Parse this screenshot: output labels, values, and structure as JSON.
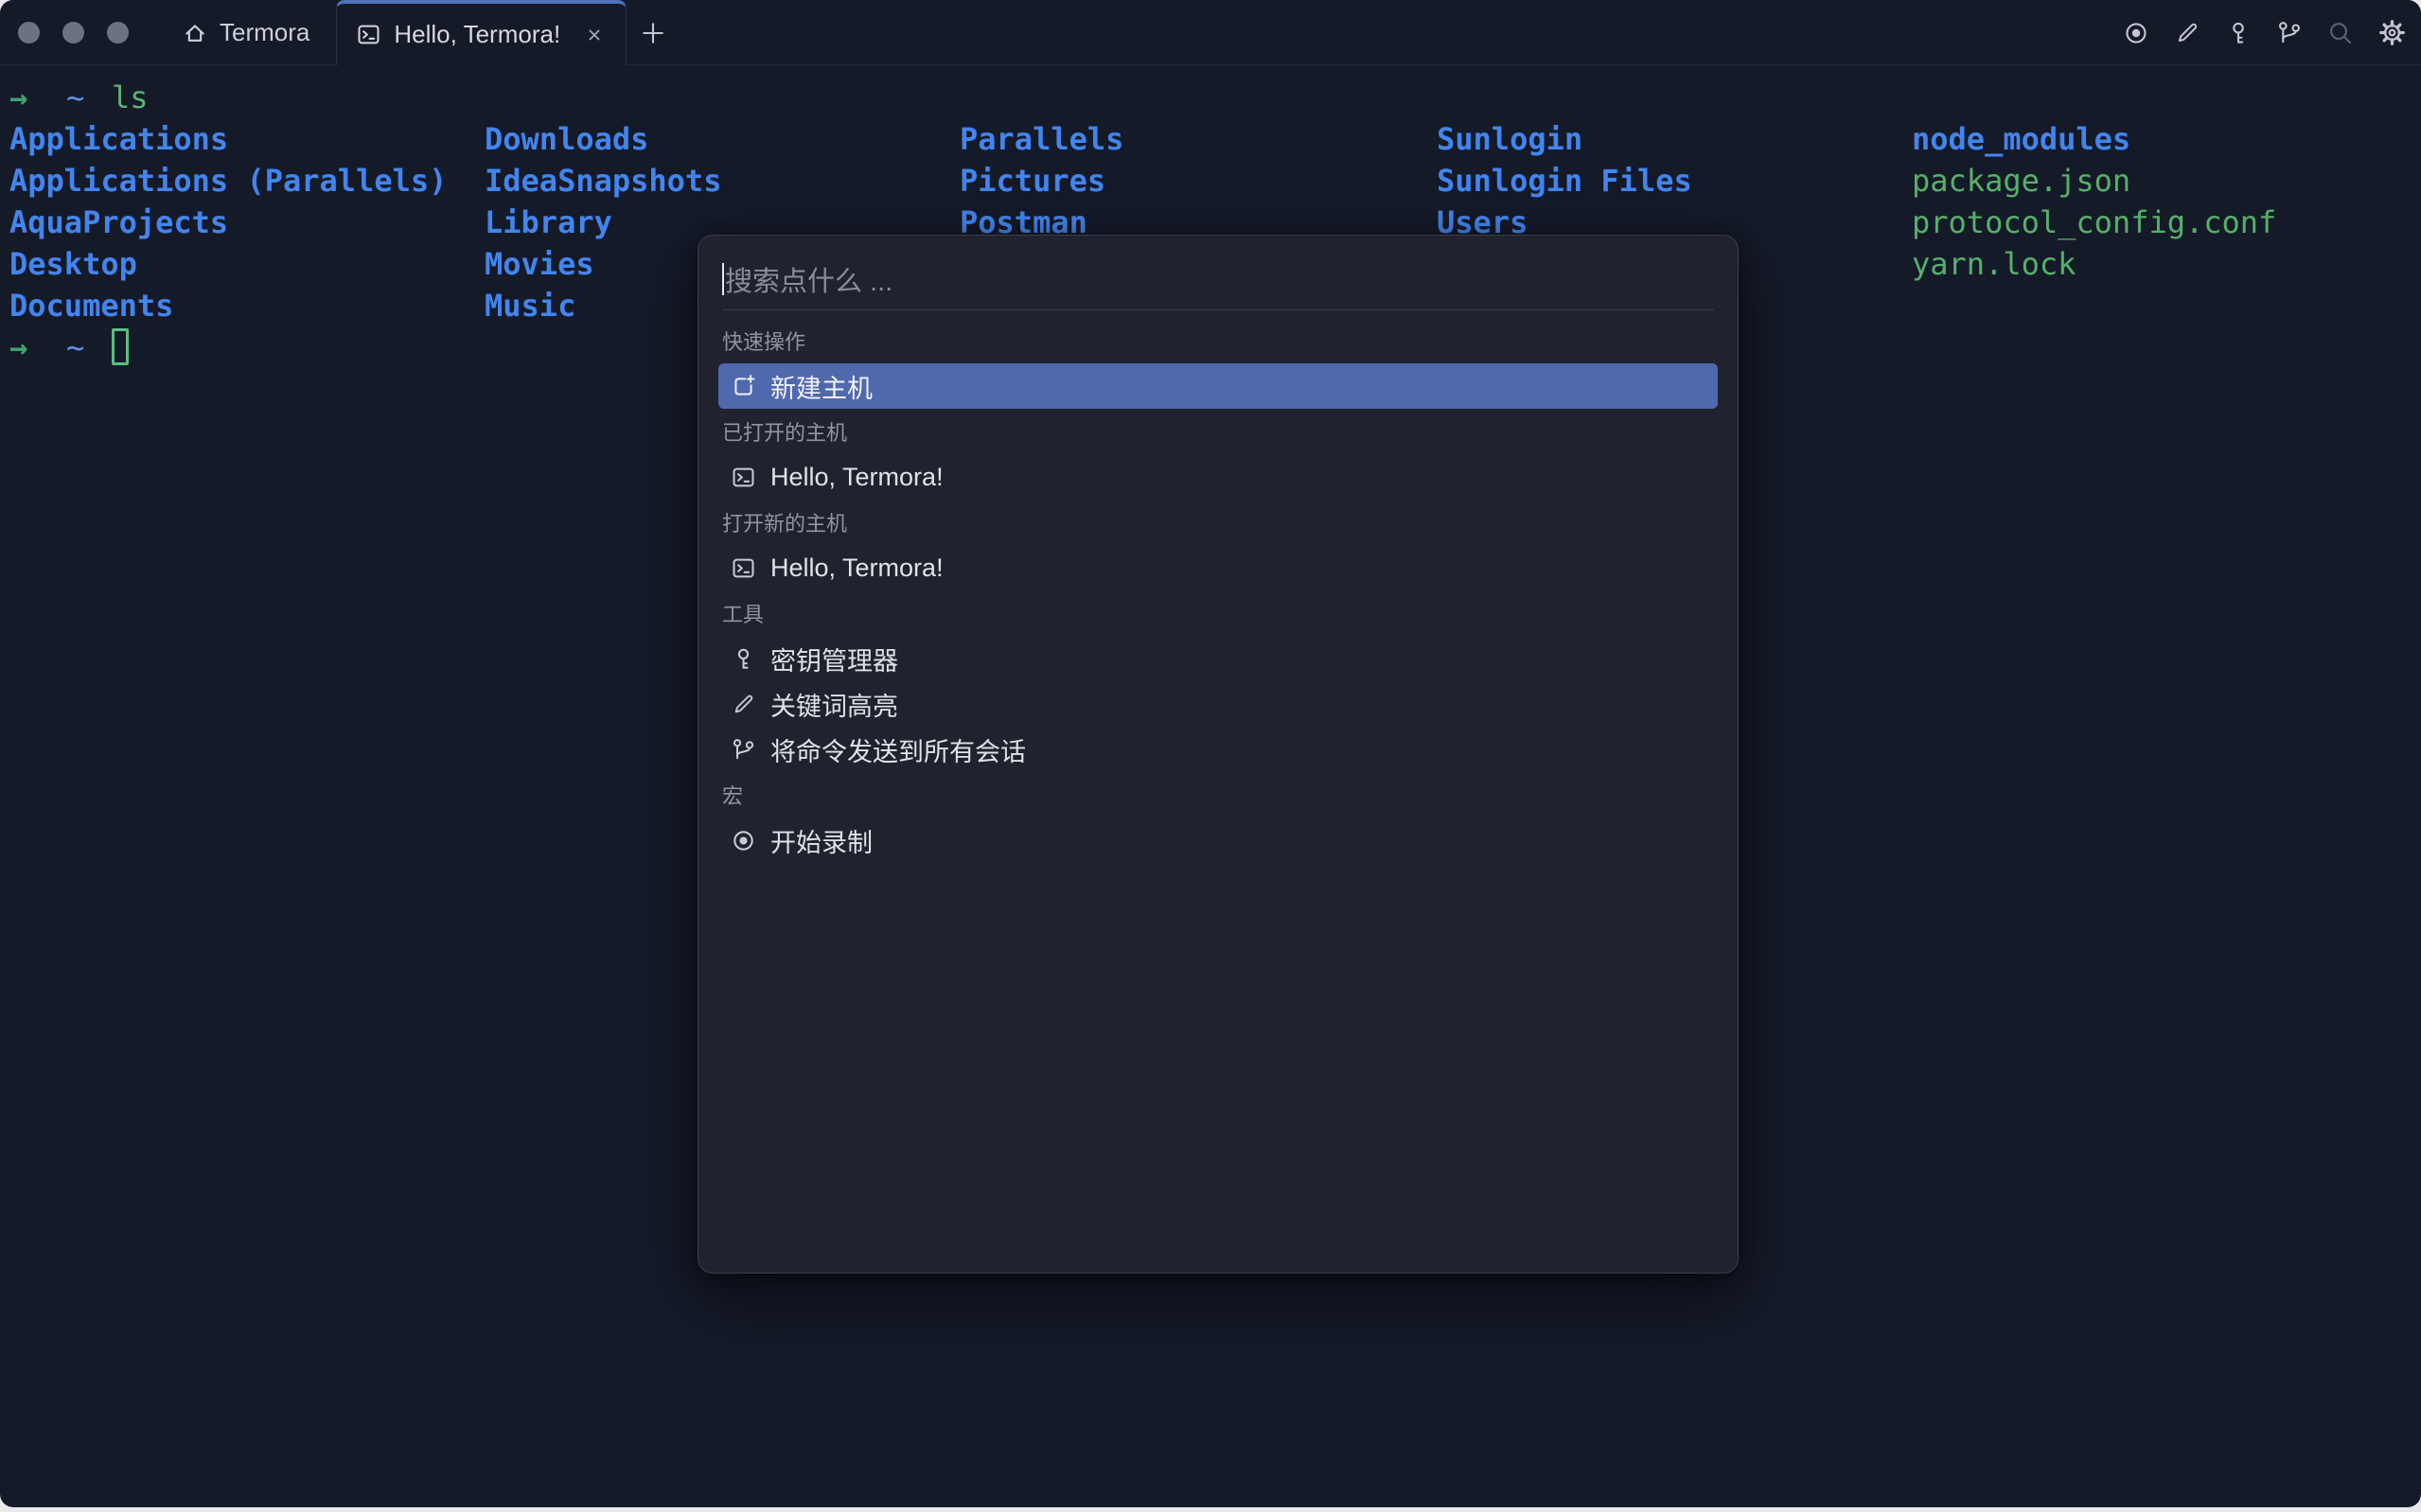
{
  "window": {
    "traffic_lights": [
      "close",
      "minimize",
      "zoom"
    ],
    "home_tab": {
      "label": "Termora",
      "icon": "home-icon"
    },
    "active_tab": {
      "label": "Hello, Termora!",
      "icon": "terminal-icon",
      "close_icon": "close-icon",
      "accent_top": "#4e73b9"
    },
    "new_tab_icon": "plus-icon",
    "action_icons": [
      "record-icon",
      "pencil-icon",
      "key-icon",
      "branch-icon",
      "search-icon",
      "gear-icon"
    ]
  },
  "terminal": {
    "prompt1": {
      "arrow": "→",
      "path": "~",
      "command": "ls"
    },
    "prompt2": {
      "arrow": "→",
      "path": "~"
    },
    "columns": [
      {
        "items": [
          {
            "text": "Applications",
            "kind": "dir"
          },
          {
            "text": "Applications (Parallels)",
            "kind": "dir"
          },
          {
            "text": "AquaProjects",
            "kind": "dir"
          },
          {
            "text": "Desktop",
            "kind": "dir"
          },
          {
            "text": "Documents",
            "kind": "dir"
          }
        ]
      },
      {
        "items": [
          {
            "text": "Downloads",
            "kind": "dir"
          },
          {
            "text": "IdeaSnapshots",
            "kind": "dir"
          },
          {
            "text": "Library",
            "kind": "dir"
          },
          {
            "text": "Movies",
            "kind": "dir"
          },
          {
            "text": "Music",
            "kind": "dir"
          }
        ]
      },
      {
        "items": [
          {
            "text": "Parallels",
            "kind": "dir"
          },
          {
            "text": "Pictures",
            "kind": "dir"
          },
          {
            "text": "Postman",
            "kind": "dir"
          }
        ]
      },
      {
        "items": [
          {
            "text": "Sunlogin",
            "kind": "dir"
          },
          {
            "text": "Sunlogin Files",
            "kind": "dir"
          },
          {
            "text": "Users",
            "kind": "dir"
          }
        ]
      },
      {
        "items": [
          {
            "text": "node_modules",
            "kind": "dir"
          },
          {
            "text": "package.json",
            "kind": "file"
          },
          {
            "text": "protocol_config.conf",
            "kind": "file"
          },
          {
            "text": "yarn.lock",
            "kind": "file"
          }
        ]
      }
    ],
    "colors": {
      "directory": "#4285ee",
      "file": "#55b169",
      "arrow": "#3fa46d",
      "path": "#6292e3",
      "command": "#5cb475",
      "cursor": "#58c07d",
      "background": "#151a29"
    }
  },
  "palette": {
    "search_placeholder": "搜索点什么 ...",
    "sections": [
      {
        "header": "快速操作",
        "items": [
          {
            "icon": "new-host-icon",
            "label": "新建主机",
            "selected": true
          }
        ]
      },
      {
        "header": "已打开的主机",
        "items": [
          {
            "icon": "terminal-icon",
            "label": "Hello, Termora!"
          }
        ]
      },
      {
        "header": "打开新的主机",
        "items": [
          {
            "icon": "terminal-icon",
            "label": "Hello, Termora!"
          }
        ]
      },
      {
        "header": "工具",
        "items": [
          {
            "icon": "key-icon",
            "label": "密钥管理器"
          },
          {
            "icon": "pencil-icon",
            "label": "关键词高亮"
          },
          {
            "icon": "branch-icon",
            "label": "将命令发送到所有会话"
          }
        ]
      },
      {
        "header": "宏",
        "items": [
          {
            "icon": "record-icon",
            "label": "开始录制"
          }
        ]
      }
    ],
    "colors": {
      "selected_row": "#5068ad",
      "background": "#20232e",
      "header_text": "#8f95a3"
    }
  }
}
